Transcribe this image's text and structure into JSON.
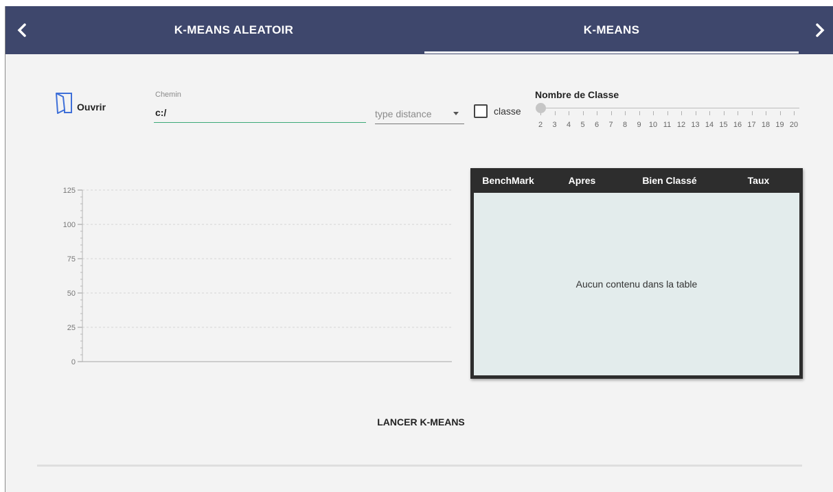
{
  "tabs": {
    "prev_icon": "chevron-left-icon",
    "next_icon": "chevron-right-icon",
    "items": [
      {
        "label": "K-MEANS ALEATOIR",
        "active": false
      },
      {
        "label": "K-MEANS",
        "active": true
      }
    ]
  },
  "controls": {
    "open_label": "Ouvrir",
    "open_icon": "folder-open-icon",
    "path_label": "Chemin",
    "path_value": "c:/",
    "distance_placeholder": "type distance",
    "class_checkbox_label": "classe",
    "class_checked": false,
    "slider_title": "Nombre de Classe",
    "slider_min": 2,
    "slider_max": 20,
    "slider_value": 2,
    "slider_labels": [
      "2",
      "3",
      "4",
      "5",
      "6",
      "7",
      "8",
      "9",
      "10",
      "11",
      "12",
      "13",
      "14",
      "15",
      "16",
      "17",
      "18",
      "19",
      "20"
    ]
  },
  "chart_data": {
    "type": "scatter",
    "title": "",
    "xlabel": "",
    "ylabel": "",
    "ylim": [
      0,
      125
    ],
    "y_ticks": [
      "0",
      "25",
      "50",
      "75",
      "100",
      "125"
    ],
    "grid": true,
    "series": []
  },
  "table": {
    "columns": [
      "BenchMark",
      "Apres",
      "Bien Classé",
      "Taux"
    ],
    "rows": [],
    "empty_message": "Aucun contenu dans la table"
  },
  "run_button_label": "LANCER K-MEANS",
  "colors": {
    "header_bg": "#3e476c",
    "accent_underline": "#3aa876",
    "table_bg": "#2d2d2d",
    "table_body_bg": "#e3ecec"
  }
}
